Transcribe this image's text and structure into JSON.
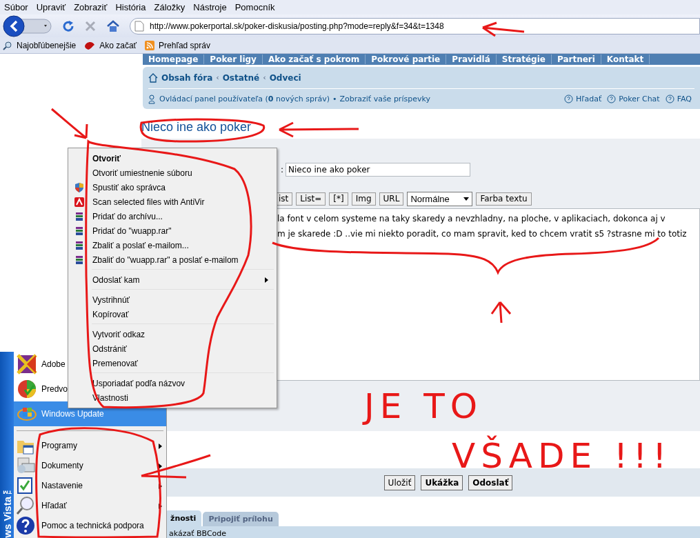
{
  "menu_bar": [
    "Súbor",
    "Upraviť",
    "Zobraziť",
    "História",
    "Záložky",
    "Nástroje",
    "Pomocník"
  ],
  "address_bar": {
    "url": "http://www.pokerportal.sk/poker-diskusia/posting.php?mode=reply&f=34&t=1348"
  },
  "bookmarks": [
    "Najobľúbenejšie",
    "Ako začať",
    "Prehľad správ"
  ],
  "site_nav": [
    "Homepage",
    "Poker ligy",
    "Ako začať s pokrom",
    "Pokrové partie",
    "Pravidlá",
    "Stratégie",
    "Partneri",
    "Kontakt"
  ],
  "breadcrumbs": [
    {
      "kind": "link",
      "text": "Obsah fóra"
    },
    {
      "kind": "separator",
      "text": "‹"
    },
    {
      "kind": "link",
      "text": "Ostatné"
    },
    {
      "kind": "separator",
      "text": "‹"
    },
    {
      "kind": "link",
      "text": "Odveci"
    }
  ],
  "user_bar": {
    "control_panel": "Ovládací panel používateľa (**0** nových správ)",
    "bullet": "•",
    "own_posts": "Zobraziť vaše príspevky",
    "links": [
      "Hľadať",
      "Poker Chat",
      "FAQ"
    ]
  },
  "topic_title": "Nieco ine ako poker",
  "subject": {
    "label": ":",
    "value": "Nieco ine ako poker"
  },
  "format_buttons": [
    "ist",
    "List=",
    "[*]",
    "Img",
    "URL"
  ],
  "font_size": "Normálne",
  "color_button": "Farba textu",
  "message_lines": [
    "la font v celom systeme na taky skaredy a nevzhladny, na ploche, v aplikaciach, dokonca aj v",
    "m je skarede :D ..vie mi niekto poradit, co mam spravit, ked to chcem vratit s5 ?strasne mi to totiz"
  ],
  "form_buttons": [
    {
      "label": "Uložiť",
      "bold": false
    },
    {
      "label": "Ukážka",
      "bold": true
    },
    {
      "label": "Odoslať",
      "bold": true
    }
  ],
  "option_tabs": [
    {
      "label": "žnosti",
      "selected": true
    },
    {
      "label": "Pripojiť prílohu",
      "selected": false
    }
  ],
  "option_text": "akázať BBCode",
  "context_menu": [
    {
      "kind": "item",
      "label": "Otvoriť",
      "bold": true,
      "submenu": false
    },
    {
      "kind": "item",
      "label": "Otvoriť umiestnenie súboru",
      "bold": false,
      "submenu": false
    },
    {
      "kind": "item",
      "label": "Spustiť ako správca",
      "bold": false,
      "submenu": false
    },
    {
      "kind": "item",
      "label": "Scan selected files with AntiVir",
      "bold": false,
      "submenu": false
    },
    {
      "kind": "item",
      "label": "Pridať do archívu...",
      "bold": false,
      "submenu": false
    },
    {
      "kind": "item",
      "label": "Pridať do \"wuapp.rar\"",
      "bold": false,
      "submenu": false
    },
    {
      "kind": "item",
      "label": "Zbaliť a poslať e-mailom...",
      "bold": false,
      "submenu": false
    },
    {
      "kind": "item",
      "label": "Zbaliť do \"wuapp.rar\" a poslať e-mailom",
      "bold": false,
      "submenu": false
    },
    {
      "kind": "separator"
    },
    {
      "kind": "item",
      "label": "Odoslať kam",
      "bold": false,
      "submenu": true
    },
    {
      "kind": "separator"
    },
    {
      "kind": "item",
      "label": "Vystrihnúť",
      "bold": false,
      "submenu": false
    },
    {
      "kind": "item",
      "label": "Kopírovať",
      "bold": false,
      "submenu": false
    },
    {
      "kind": "separator"
    },
    {
      "kind": "item",
      "label": "Vytvoriť odkaz",
      "bold": false,
      "submenu": false
    },
    {
      "kind": "item",
      "label": "Odstrániť",
      "bold": false,
      "submenu": false
    },
    {
      "kind": "item",
      "label": "Premenovať",
      "bold": false,
      "submenu": false
    },
    {
      "kind": "separator"
    },
    {
      "kind": "item",
      "label": "Usporiadať podľa názvov",
      "bold": false,
      "submenu": false
    },
    {
      "kind": "item",
      "label": "Vlastnosti",
      "bold": false,
      "submenu": false
    }
  ],
  "start_menu": {
    "brand": "ws Vista™",
    "pinned": [
      {
        "label": "Adobe",
        "selected": false
      },
      {
        "label": "Predvo",
        "selected": false
      },
      {
        "label": "Windows Update",
        "selected": true
      }
    ],
    "items": [
      {
        "label": "Programy",
        "submenu": true
      },
      {
        "label": "Dokumenty",
        "submenu": true
      },
      {
        "label": "Nastavenie",
        "submenu": true
      },
      {
        "label": "Hľadať",
        "submenu": true
      },
      {
        "label": "Pomoc a technická podpora",
        "submenu": false
      }
    ]
  },
  "annotation": [
    "JE TO",
    "VŠADE !!!"
  ]
}
